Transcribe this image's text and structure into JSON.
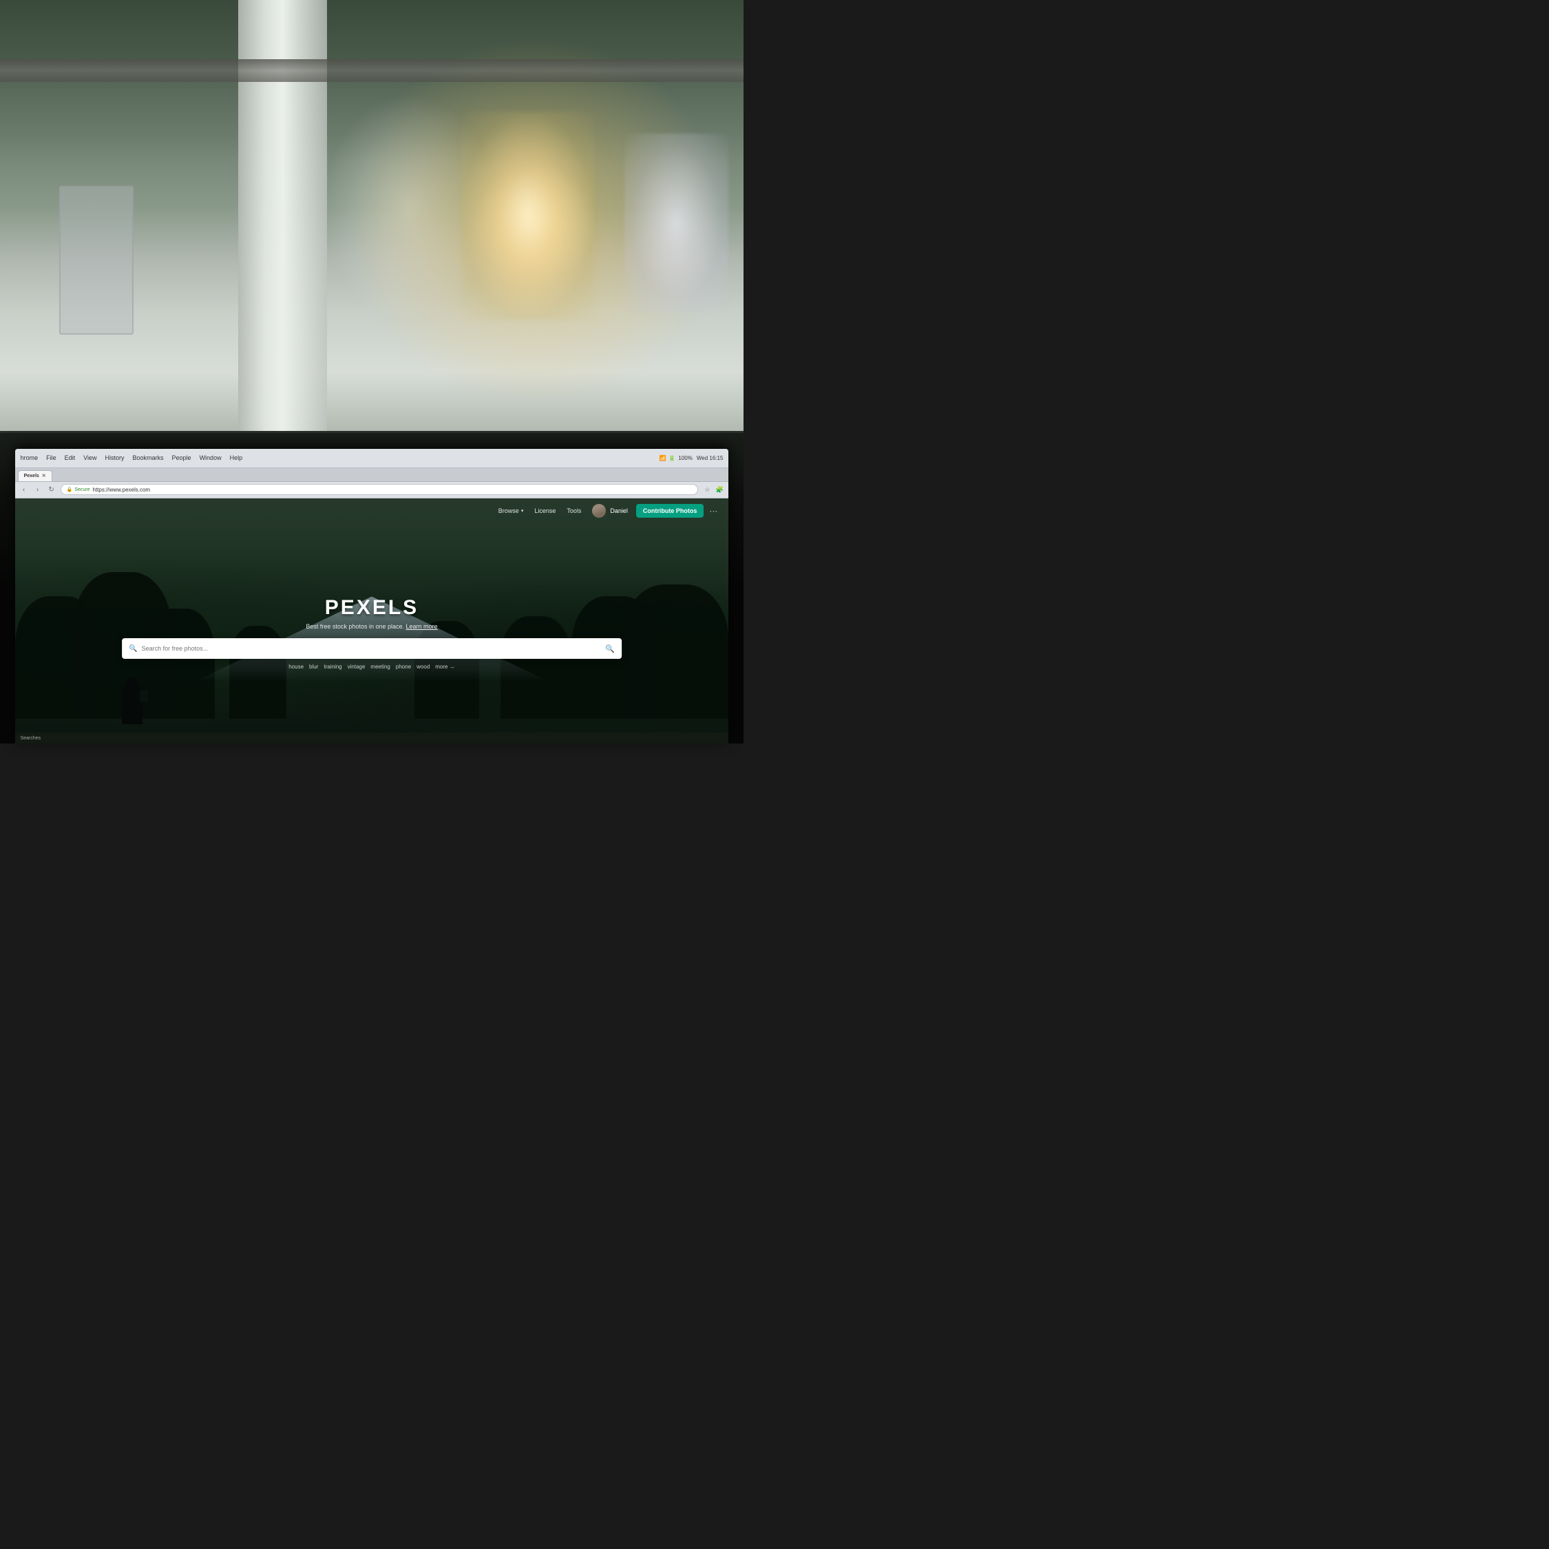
{
  "scene": {
    "background_desc": "Office interior with bokeh, plants, windows"
  },
  "browser": {
    "menu_items": [
      "hrome",
      "File",
      "Edit",
      "View",
      "History",
      "Bookmarks",
      "People",
      "Window",
      "Help"
    ],
    "system_time": "Wed 16:15",
    "battery": "100%",
    "address": "https://www.pexels.com",
    "secure_label": "Secure",
    "tab_label": "Pexels"
  },
  "pexels": {
    "nav": {
      "browse_label": "Browse",
      "license_label": "License",
      "tools_label": "Tools",
      "user_name": "Daniel",
      "contribute_label": "Contribute Photos",
      "more_label": "···"
    },
    "hero": {
      "logo": "PEXELS",
      "tagline": "Best free stock photos in one place.",
      "learn_more": "Learn more",
      "search_placeholder": "Search for free photos..."
    },
    "search_tags": [
      "house",
      "blur",
      "training",
      "vintage",
      "meeting",
      "phone",
      "wood",
      "more →"
    ]
  },
  "bottombar": {
    "label": "Searches"
  }
}
